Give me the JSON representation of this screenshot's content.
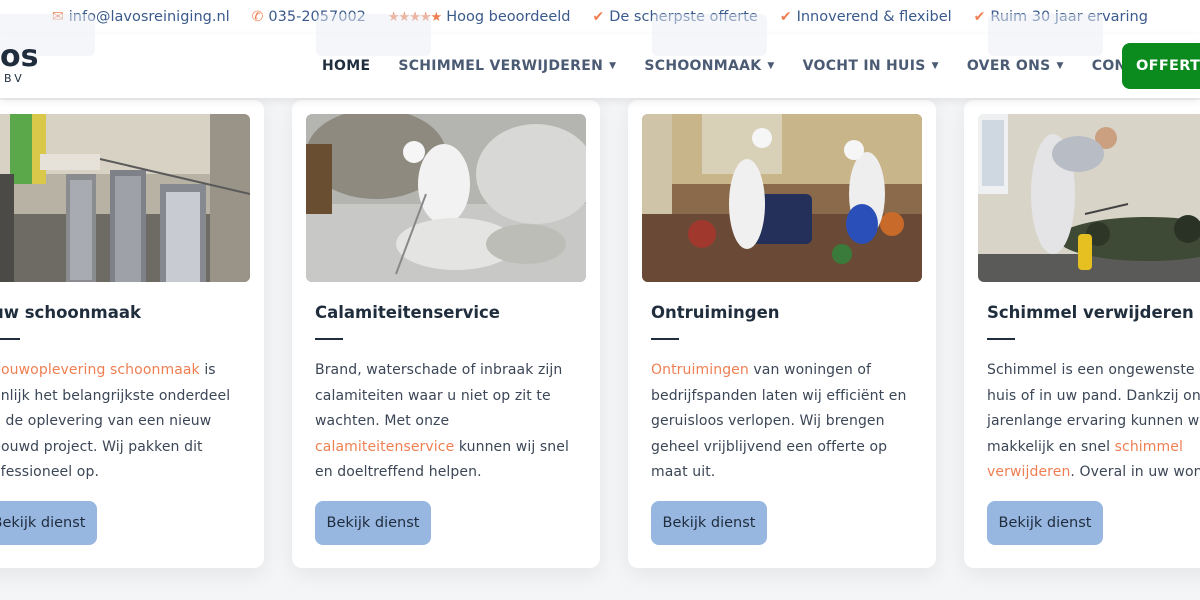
{
  "topbar": {
    "email": "info@lavosreiniging.nl",
    "phone": "035-2057002",
    "rating_stars": "★★★★★",
    "rating_text": "Hoog beoordeeld",
    "usp1": "De scherpste offerte",
    "usp2": "Innoverend & flexibel",
    "usp3": "Ruim 30 jaar ervaring",
    "accent_color": "#ef7f52",
    "text_color": "#3a5a8c"
  },
  "header": {
    "logo_text": "os",
    "logo_sub": "BV",
    "nav": [
      {
        "label": "HOME"
      },
      {
        "label": "SCHIMMEL VERWIJDEREN"
      },
      {
        "label": "SCHOONMAAK"
      },
      {
        "label": "VOCHT IN HUIS"
      },
      {
        "label": "OVER ONS"
      },
      {
        "label": "CONTACT"
      }
    ],
    "cta_label": "OFFERTE",
    "cta_color": "#0b8a1e"
  },
  "cards": [
    {
      "title": "uw schoonmaak",
      "link_text": "bouwoplevering schoonmaak",
      "line1_after": " is",
      "line2": "enlijk het belangrijkste onderdeel",
      "line3": "n de oplevering van een nieuw",
      "line4": "bouwd project. Wij pakken dit",
      "line5": "ofessioneel op.",
      "button": "Bekijk dienst"
    },
    {
      "title": "Calamiteitenservice",
      "before_link": "Brand, waterschade of inbraak zijn calamiteiten waar u niet op zit te wachten. Met onze ",
      "link_text": "calamiteitenservice",
      "after_link": " kunnen wij snel en doeltreffend helpen.",
      "button": "Bekijk dienst"
    },
    {
      "title": "Ontruimingen",
      "before_link": "",
      "link_text": "Ontruimingen",
      "after_link": " van woningen of bedrijfspanden laten wij efficiënt en geruisloos verlopen. Wij brengen geheel vrijblijvend een offerte op maat uit.",
      "button": "Bekijk dienst"
    },
    {
      "title": "Schimmel verwijderen",
      "line1": "Schimmel is een ongewenste ga",
      "line2": "huis of in uw pand. Dankzij onze",
      "line3": "jarenlange ervaring kunnen wij",
      "line4_before": "makkelijk en snel ",
      "link_a": "schimmel",
      "link_b": "verwijderen",
      "line5_after": ". Overal in uw wonin",
      "button": "Bekijk dienst"
    }
  ],
  "button_color": "#97b6e0"
}
